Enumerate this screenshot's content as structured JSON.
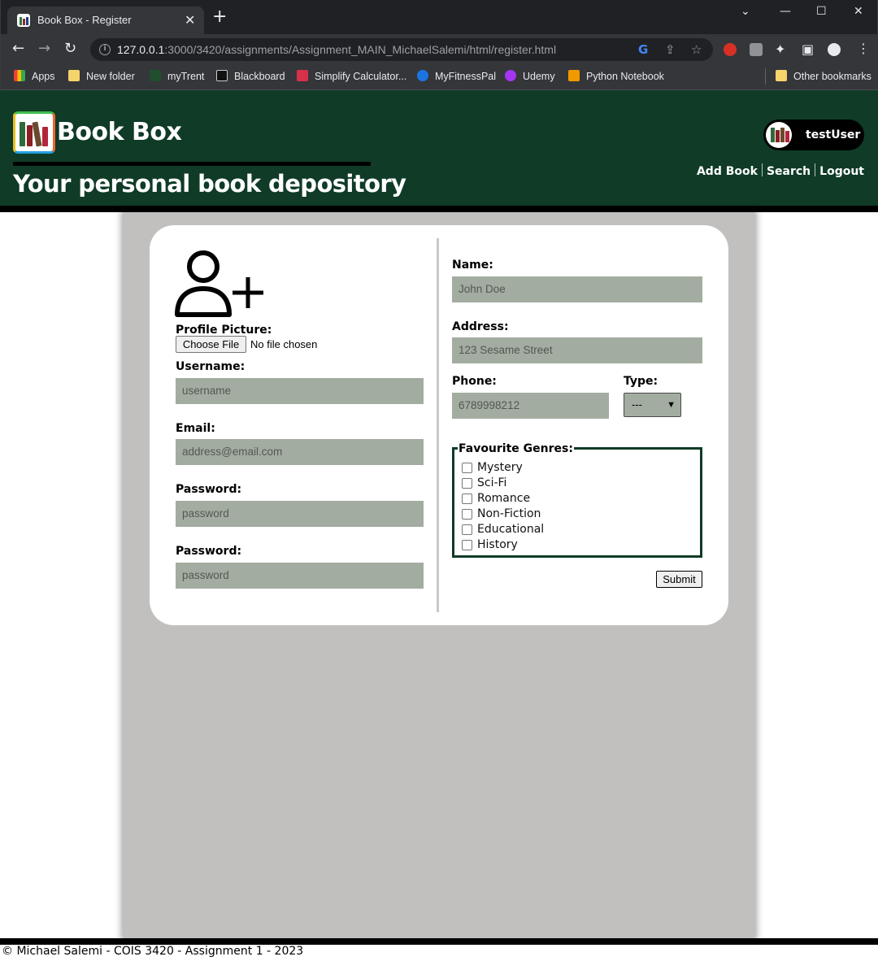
{
  "browser": {
    "tab_title": "Book Box - Register",
    "new_tab_symbol": "+",
    "url_host": "127.0.0.1",
    "url_path": ":3000/3420/assignments/Assignment_MAIN_MichaelSalemi/html/register.html",
    "bookmarks": [
      "Apps",
      "New folder",
      "myTrent",
      "Blackboard",
      "Simplify Calculator...",
      "MyFitnessPal",
      "Udemy",
      "Python Notebook"
    ],
    "other_bookmarks": "Other bookmarks"
  },
  "header": {
    "site_title": "Book Box",
    "tagline": "Your personal book depository",
    "username": "testUser",
    "nav": [
      "Add Book",
      "Search",
      "Logout"
    ],
    "colors": {
      "header_bg": "#0f3b27",
      "accent": "#000000"
    }
  },
  "form": {
    "profile_picture_label": "Profile Picture:",
    "file_button": "Choose File",
    "file_status": "No file chosen",
    "username_label": "Username:",
    "username_placeholder": "username",
    "email_label": "Email:",
    "email_placeholder": "address@email.com",
    "password_label": "Password:",
    "password_placeholder": "password",
    "password2_label": "Password:",
    "password2_placeholder": "password",
    "name_label": "Name:",
    "name_placeholder": "John Doe",
    "address_label": "Address:",
    "address_placeholder": "123 Sesame Street",
    "phone_label": "Phone:",
    "phone_placeholder": "6789998212",
    "type_label": "Type:",
    "type_value": "---",
    "genres_legend": "Favourite Genres:",
    "genres": [
      "Mystery",
      "Sci-Fi",
      "Romance",
      "Non-Fiction",
      "Educational",
      "History"
    ],
    "submit_label": "Submit"
  },
  "footer": {
    "text": "© Michael Salemi - COIS 3420 - Assignment 1 - 2023"
  }
}
